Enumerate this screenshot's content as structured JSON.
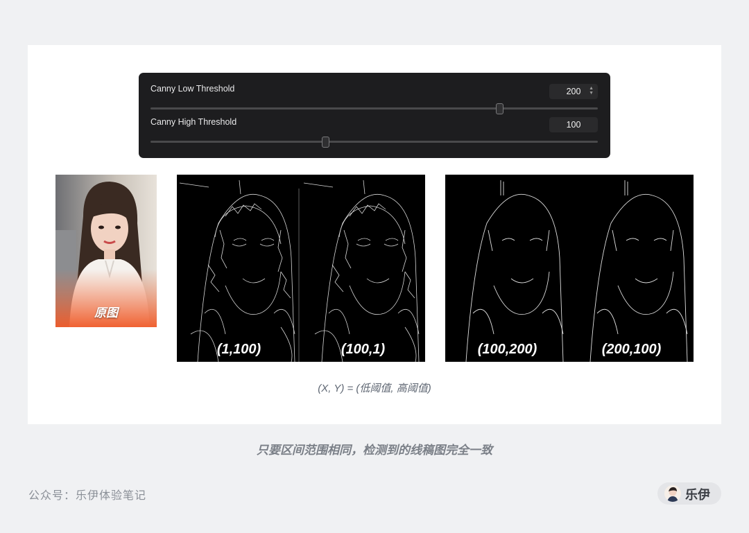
{
  "controls": {
    "low": {
      "label": "Canny Low Threshold",
      "value": "200",
      "slider_fraction": 0.78
    },
    "high": {
      "label": "Canny High Threshold",
      "value": "100",
      "slider_fraction": 0.39
    }
  },
  "photo": {
    "label": "原图"
  },
  "edge_panels": [
    {
      "left_label": "(1,100)",
      "right_label": "(100,1)"
    },
    {
      "left_label": "(100,200)",
      "right_label": "(200,100)"
    }
  ],
  "caption": "(X, Y) = (低阈值, 高阈值)",
  "summary": "只要区间范围相同，检测到的线稿图完全一致",
  "footer": {
    "account": "公众号：乐伊体验笔记",
    "author": "乐伊"
  },
  "colors": {
    "panel_bg": "#1d1d1f",
    "orange": "#f06a3a",
    "page_bg": "#f0f1f3"
  }
}
